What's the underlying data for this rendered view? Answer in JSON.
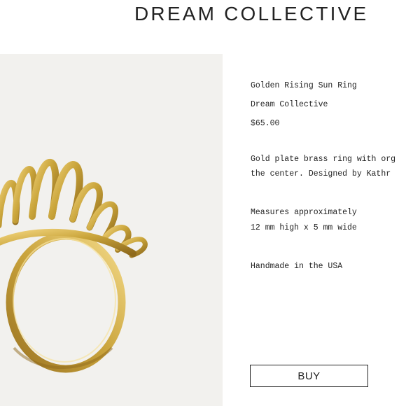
{
  "header": {
    "brand": "DREAM COLLECTIVE"
  },
  "product": {
    "name": "Golden Rising Sun Ring",
    "vendor": "Dream Collective",
    "price": "$65.00",
    "description_line1": "Gold plate brass ring with org",
    "description_line2": "the center.  Designed by Kathr",
    "measures_line1": "Measures approximately",
    "measures_line2": "12 mm high x 5 mm wide",
    "origin": "Handmade in the USA",
    "buy_label": "BUY"
  },
  "colors": {
    "image_background": "#f2f1ee",
    "gold": "#c9a43a",
    "text": "#222222"
  },
  "icons": {
    "product_image": "gold-ring-photo"
  }
}
